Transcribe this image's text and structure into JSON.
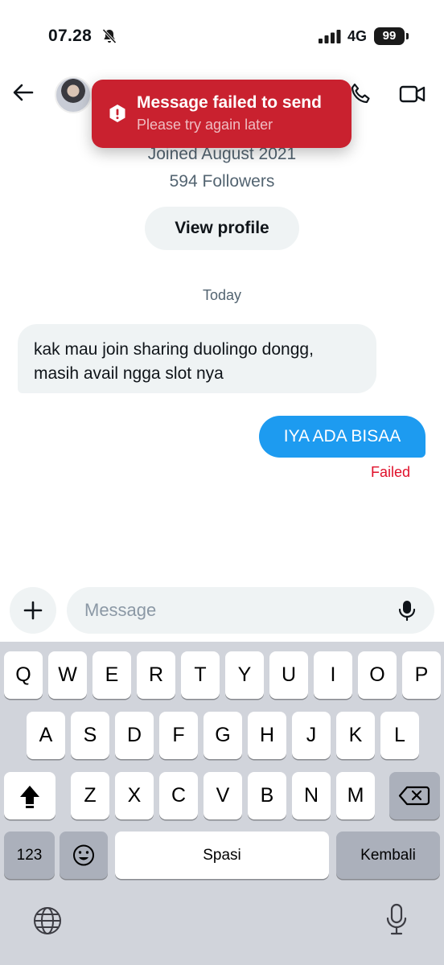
{
  "status_bar": {
    "time": "07.28",
    "network": "4G",
    "battery": "99"
  },
  "toast": {
    "title": "Message failed to send",
    "subtitle": "Please try again later",
    "color": "#c9212f"
  },
  "profile": {
    "joined": "Joined August 2021",
    "followers": "594 Followers",
    "view_profile_label": "View profile"
  },
  "conversation": {
    "date_separator": "Today",
    "incoming_message": "kak mau join sharing duolingo dongg, masih avail ngga slot nya",
    "outgoing_message": "IYA ADA BISAA",
    "outgoing_status": "Failed"
  },
  "composer": {
    "placeholder": "Message"
  },
  "keyboard": {
    "row1": [
      "Q",
      "W",
      "E",
      "R",
      "T",
      "Y",
      "U",
      "I",
      "O",
      "P"
    ],
    "row2": [
      "A",
      "S",
      "D",
      "F",
      "G",
      "H",
      "J",
      "K",
      "L"
    ],
    "row3": [
      "Z",
      "X",
      "C",
      "V",
      "B",
      "N",
      "M"
    ],
    "numbers_label": "123",
    "space_label": "Spasi",
    "return_label": "Kembali"
  },
  "icons": [
    "back-arrow-icon",
    "phone-icon",
    "video-camera-icon",
    "alert-icon",
    "plus-icon",
    "microphone-icon",
    "shift-icon",
    "backspace-icon",
    "emoji-icon",
    "globe-icon",
    "bell-slash-icon",
    "signal-icon"
  ],
  "colors": {
    "accent": "#1d9bf0",
    "error": "#e0102a"
  }
}
